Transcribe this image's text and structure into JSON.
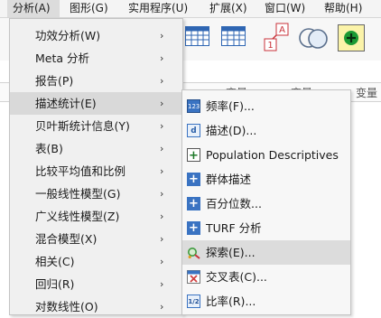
{
  "menubar": {
    "items": [
      {
        "label": "分析(A)",
        "active": true
      },
      {
        "label": "图形(G)"
      },
      {
        "label": "实用程序(U)"
      },
      {
        "label": "扩展(X)"
      },
      {
        "label": "窗口(W)"
      },
      {
        "label": "帮助(H)"
      }
    ]
  },
  "grid": {
    "headers": [
      "变量",
      "变量",
      "变量"
    ]
  },
  "analyze_menu": {
    "items": [
      {
        "label": "功效分析(W)",
        "submenu": true
      },
      {
        "label": "Meta 分析",
        "submenu": true
      },
      {
        "label": "报告(P)",
        "submenu": true
      },
      {
        "label": "描述统计(E)",
        "submenu": true,
        "highlight": true
      },
      {
        "label": "贝叶斯统计信息(Y)",
        "submenu": true
      },
      {
        "label": "表(B)",
        "submenu": true
      },
      {
        "label": "比较平均值和比例",
        "submenu": true
      },
      {
        "label": "一般线性模型(G)",
        "submenu": true
      },
      {
        "label": "广义线性模型(Z)",
        "submenu": true
      },
      {
        "label": "混合模型(X)",
        "submenu": true
      },
      {
        "label": "相关(C)",
        "submenu": true
      },
      {
        "label": "回归(R)",
        "submenu": true
      },
      {
        "label": "对数线性(O)",
        "submenu": true
      }
    ],
    "arrow_glyph": "›"
  },
  "descriptive_menu": {
    "items": [
      {
        "label": "频率(F)...",
        "icon": "frequencies-icon",
        "icon_text": "123",
        "icon_color": "#3a73c2"
      },
      {
        "label": "描述(D)...",
        "icon": "descriptives-icon",
        "icon_text": "d",
        "icon_color": "#3a73c2"
      },
      {
        "label": "Population Descriptives",
        "icon": "population-descriptives-icon",
        "icon_text": "+",
        "icon_color": "#3a8a3a"
      },
      {
        "label": "群体描述",
        "icon": "group-descriptives-icon",
        "icon_text": "+",
        "icon_color": "#3a73c2"
      },
      {
        "label": "百分位数...",
        "icon": "percentiles-icon",
        "icon_text": "+",
        "icon_color": "#3a73c2"
      },
      {
        "label": "TURF 分析",
        "icon": "turf-analysis-icon",
        "icon_text": "+",
        "icon_color": "#3a73c2"
      },
      {
        "label": "探索(E)...",
        "icon": "explore-icon",
        "icon_text": "",
        "icon_color": "#3f9a3f",
        "highlight": true
      },
      {
        "label": "交叉表(C)...",
        "icon": "crosstabs-icon",
        "icon_text": "X",
        "icon_color": "#d04040"
      },
      {
        "label": "比率(R)...",
        "icon": "ratio-icon",
        "icon_text": "1/2",
        "icon_color": "#3a73c2"
      }
    ]
  },
  "colors": {
    "menubar_bg": "#f4f4f4",
    "menu_bg": "#f0f0f0",
    "highlight_bg": "#d9d9d9",
    "accent_blue": "#3a73c2"
  }
}
